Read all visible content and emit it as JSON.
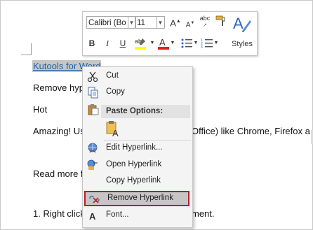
{
  "document": {
    "link_text": "Kutools for Word",
    "line2": "Remove hyp",
    "line3": "Hot",
    "line4_left": "Amazing! Us",
    "line4_right": "Office) like Chrome, Firefox a",
    "line5": "Read more f",
    "line6_left": "1. Right click",
    "line6_right": "ment."
  },
  "mini_toolbar": {
    "font_name": "Calibri (Bo",
    "font_size": "11",
    "grow_font": "A",
    "shrink_font": "A",
    "bold": "B",
    "italic": "I",
    "underline": "U",
    "font_color": "A",
    "styles_label": "Styles"
  },
  "context_menu": {
    "items": [
      {
        "label": "Cut",
        "icon": "scissors-icon"
      },
      {
        "label": "Copy",
        "icon": "copy-icon"
      },
      {
        "label": "Paste Options:",
        "icon": "clipboard-icon"
      },
      {
        "label": "Edit Hyperlink...",
        "icon": "edit-hyperlink-icon"
      },
      {
        "label": "Open Hyperlink",
        "icon": "open-hyperlink-icon"
      },
      {
        "label": "Copy Hyperlink",
        "icon": ""
      },
      {
        "label": "Remove Hyperlink",
        "icon": "remove-hyperlink-icon"
      },
      {
        "label": "Font...",
        "icon": "font-icon"
      }
    ]
  },
  "colors": {
    "highlight_border": "#b0202a",
    "link": "#1f5fa8",
    "selection": "#c6c6c6"
  }
}
